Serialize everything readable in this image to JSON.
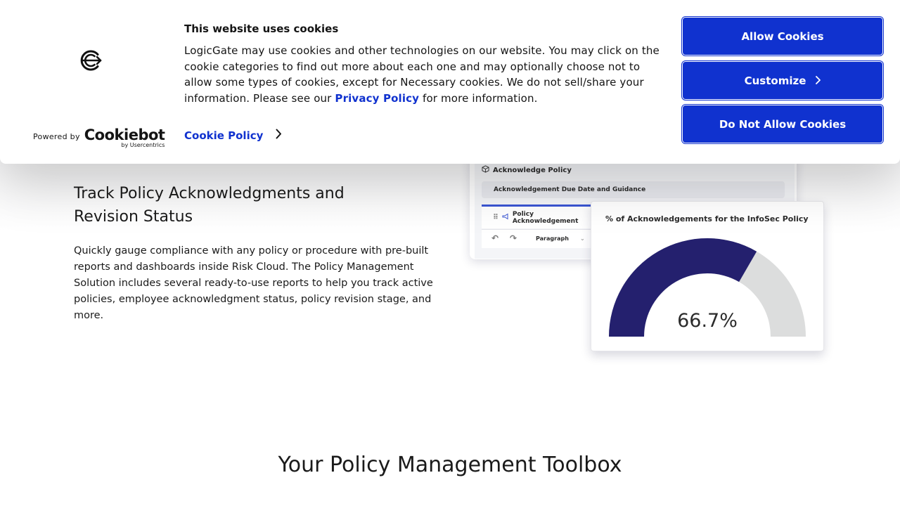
{
  "cookie_banner": {
    "title": "This website uses cookies",
    "body_text": "LogicGate may use cookies and other technologies on our website. You may click on the cookie categories to find out more about each one and may optionally choose not to allow some types of cookies, except for Necessary cookies.  We do not sell/share your information. Please see our ",
    "privacy_link": "Privacy Policy",
    "body_suffix": " for more information.",
    "cookie_policy_link": "Cookie Policy",
    "powered_by": "Powered by",
    "provider_name": "Cookiebot",
    "provider_sub": "by Usercentrics",
    "buttons": {
      "allow": "Allow Cookies",
      "customize": "Customize",
      "deny": "Do Not Allow Cookies"
    },
    "accent_color": "#1032cf"
  },
  "feature": {
    "title": "Track Policy Acknowledgments and Revision Status",
    "body": "Quickly gauge compliance with any policy or procedure with pre-built reports and dashboards inside Risk Cloud. The Policy Management Solution includes several ready-to-use reports to help you track active policies, employee acknowledgment status, policy revision stage, and more."
  },
  "mockup": {
    "header": "Acknowledge Policy",
    "field": "Acknowledgement Due Date and Guidance",
    "tab": "Policy Acknowledgement",
    "toolbar_style": "Paragraph"
  },
  "gauge": {
    "title": "% of Acknowledgements for the InfoSec Policy",
    "value_label": "66.7%",
    "fraction": 0.667,
    "fill_color": "#24206e",
    "track_color": "#dcdddd"
  },
  "section": {
    "title": "Your Policy Management Toolbox"
  }
}
